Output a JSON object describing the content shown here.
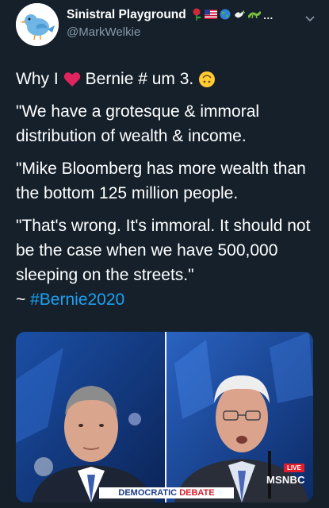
{
  "tweet": {
    "display_name": "Sinistral Playground",
    "handle": "@MarkWelkie",
    "name_emoji_icons": [
      "rose-icon",
      "us-flag-icon",
      "globe-icon",
      "dove-icon",
      "lizard-icon",
      "ellipsis-icon"
    ],
    "line1_prefix": "Why I",
    "line1_suffix": "Bernie # um 3.",
    "paragraphs": [
      "\"We have a grotesque & immoral distribution of wealth & income.",
      "\"Mike Bloomberg has more wealth than the bottom 125 million people.",
      "\"That's wrong. It's immoral. It should not be the case when we have 500,000 sleeping on the streets.\""
    ],
    "tag_prefix": "~ ",
    "hashtag": "#Bernie2020"
  },
  "media": {
    "live_label": "LIVE",
    "network_label": "MSNBC",
    "banner_part1": "DEMOCRATIC",
    "banner_part2": "DEBATE"
  },
  "colors": {
    "background": "#15202b",
    "text": "#ffffff",
    "secondary_text": "#8899a6",
    "hashtag": "#1da1f2",
    "heart": "#e0245e"
  }
}
